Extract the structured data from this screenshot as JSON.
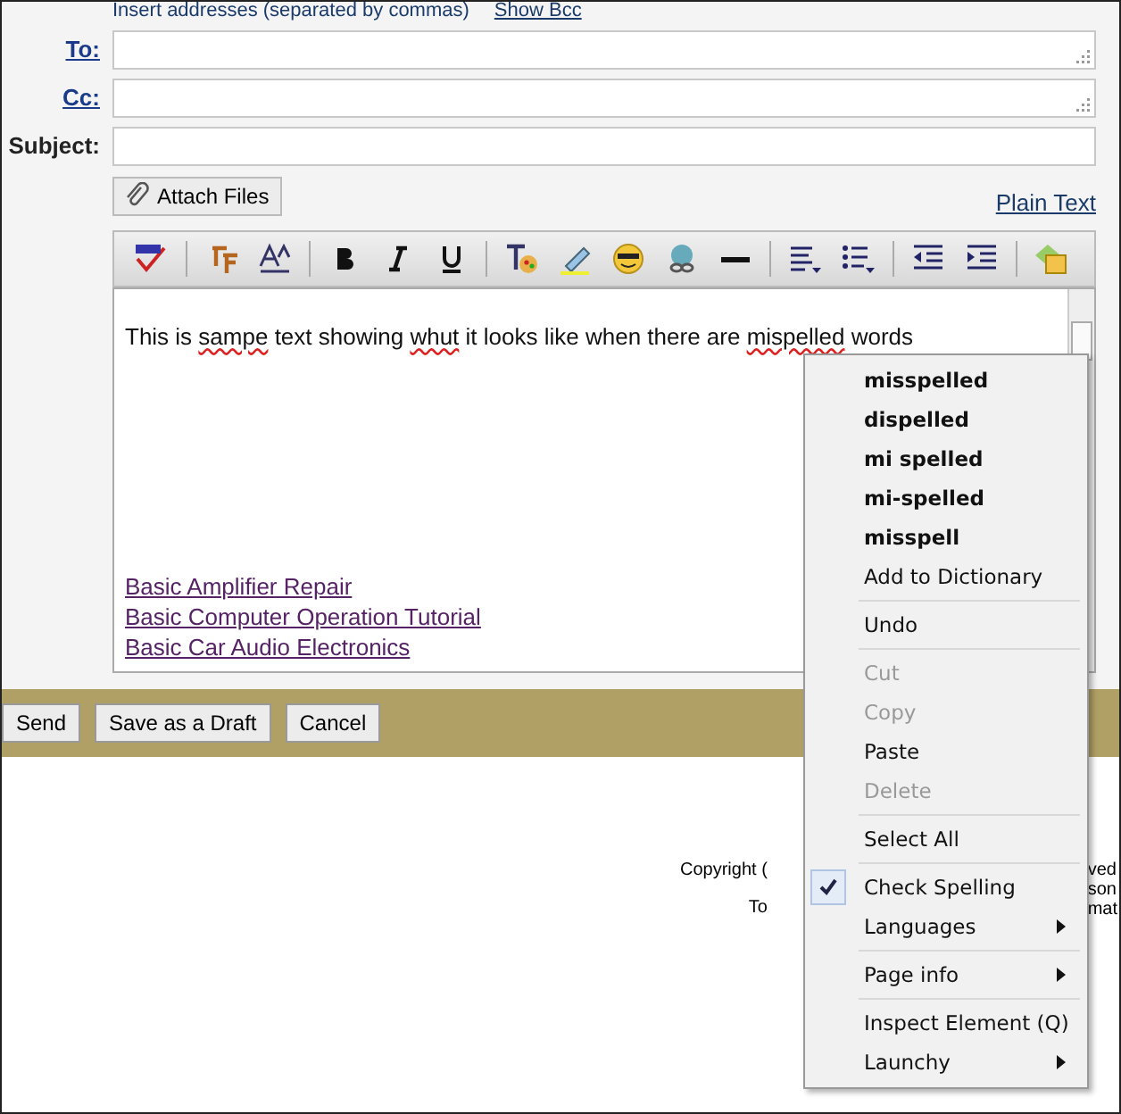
{
  "hint": {
    "text": "Insert addresses (separated by commas)",
    "link": "Show Bcc"
  },
  "fields": [
    {
      "label": "To:",
      "link": true,
      "resizable": true
    },
    {
      "label": "Cc:",
      "link": true,
      "resizable": true
    },
    {
      "label": "Subject:",
      "link": false,
      "resizable": false
    }
  ],
  "attach_button": "Attach Files",
  "plain_text_link": "Plain Text",
  "editor": {
    "segments": [
      {
        "text": "This is ",
        "misspelled": false
      },
      {
        "text": "sampe",
        "misspelled": true
      },
      {
        "text": " text showing ",
        "misspelled": false
      },
      {
        "text": "whut",
        "misspelled": true
      },
      {
        "text": " it looks like when there are ",
        "misspelled": false
      },
      {
        "text": "mispelled",
        "misspelled": true
      },
      {
        "text": " words",
        "misspelled": false
      }
    ],
    "links": [
      "Basic Amplifier Repair",
      "Basic Computer Operation Tutorial",
      "Basic Car Audio Electronics"
    ]
  },
  "actions": [
    "Send",
    "Save as a Draft",
    "Cancel"
  ],
  "footer": {
    "left": [
      "Copyright (",
      "To"
    ],
    "right": [
      "ved",
      "son",
      "mat"
    ]
  },
  "context_menu": [
    {
      "kind": "suggestion",
      "label": "misspelled",
      "disabled": false,
      "checked": false,
      "submenu": false
    },
    {
      "kind": "suggestion",
      "label": "dispelled",
      "disabled": false,
      "checked": false,
      "submenu": false
    },
    {
      "kind": "suggestion",
      "label": "mi spelled",
      "disabled": false,
      "checked": false,
      "submenu": false
    },
    {
      "kind": "suggestion",
      "label": "mi-spelled",
      "disabled": false,
      "checked": false,
      "submenu": false
    },
    {
      "kind": "suggestion",
      "label": "misspell",
      "disabled": false,
      "checked": false,
      "submenu": false
    },
    {
      "kind": "item",
      "label": "Add to Dictionary",
      "disabled": false,
      "checked": false,
      "submenu": false
    },
    {
      "kind": "separator"
    },
    {
      "kind": "item",
      "label": "Undo",
      "disabled": false,
      "checked": false,
      "submenu": false
    },
    {
      "kind": "separator"
    },
    {
      "kind": "item",
      "label": "Cut",
      "disabled": true,
      "checked": false,
      "submenu": false
    },
    {
      "kind": "item",
      "label": "Copy",
      "disabled": true,
      "checked": false,
      "submenu": false
    },
    {
      "kind": "item",
      "label": "Paste",
      "disabled": false,
      "checked": false,
      "submenu": false
    },
    {
      "kind": "item",
      "label": "Delete",
      "disabled": true,
      "checked": false,
      "submenu": false
    },
    {
      "kind": "separator"
    },
    {
      "kind": "item",
      "label": "Select All",
      "disabled": false,
      "checked": false,
      "submenu": false
    },
    {
      "kind": "separator"
    },
    {
      "kind": "item",
      "label": "Check Spelling",
      "disabled": false,
      "checked": true,
      "submenu": false
    },
    {
      "kind": "item",
      "label": "Languages",
      "disabled": false,
      "checked": false,
      "submenu": true
    },
    {
      "kind": "separator"
    },
    {
      "kind": "item",
      "label": "Page info",
      "disabled": false,
      "checked": false,
      "submenu": true
    },
    {
      "kind": "separator"
    },
    {
      "kind": "item",
      "label": "Inspect Element (Q)",
      "disabled": false,
      "checked": false,
      "submenu": false
    },
    {
      "kind": "item",
      "label": "Launchy",
      "disabled": false,
      "checked": false,
      "submenu": true
    }
  ]
}
